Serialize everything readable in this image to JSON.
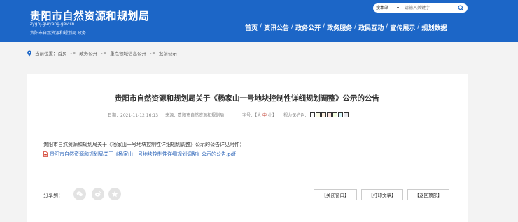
{
  "header": {
    "site_title": "贵阳市自然资源和规划局",
    "site_url": "zyghj.guiyang.gov.cn",
    "site_sub": "贵阳市自然资源和规划局.政务"
  },
  "search": {
    "scope": "搜本站",
    "placeholder": "请输入关键字"
  },
  "nav": {
    "items": [
      "首页",
      "资讯公告",
      "政务公开",
      "政务服务",
      "政民互动",
      "宣传展示",
      "规划数据"
    ],
    "separator": "/"
  },
  "breadcrumb": {
    "prefix": "当前位置：",
    "items": [
      "首页",
      "政务公开",
      "重点领域信息公开",
      "批前公示"
    ],
    "separator": "->"
  },
  "article": {
    "title": "贵阳市自然资源和规划局关于《杨家山一号地块控制性详细规划调整》公示的公告",
    "date": "日期：2021-11-12 16:13",
    "source": "来源：贵阳市自然资源和规划局",
    "font_size_label": "字号：【",
    "font_large": "大",
    "font_medium": "中",
    "font_small": "小",
    "font_size_end": "】",
    "vision_label": "视力保护色：",
    "vision_colors": [
      "#ffffff",
      "#fafbe6",
      "#fff2e2",
      "#fde6e0",
      "#f3ffe1",
      "#dafaff",
      "#eaeaef"
    ],
    "body": "贵阳市自然资源和规划局关于《杨家山一号地块控制性详细规划调整》公示的公告详见附件：",
    "attachment": "贵阳市自然资源和规划局关于《杨家山一号地块控制性详细规划调整》公示的公告.pdf"
  },
  "share": {
    "label": "分享到：",
    "icons": [
      "wechat-icon",
      "weibo-icon",
      "qzone-icon"
    ]
  },
  "actions": {
    "close": "【关闭窗口】",
    "print": "【打印文章】",
    "top": "【返回顶部】"
  },
  "colors": {
    "header_bg": "#1c66c7",
    "link": "#2a63b8",
    "accent_red": "#c0392b"
  }
}
